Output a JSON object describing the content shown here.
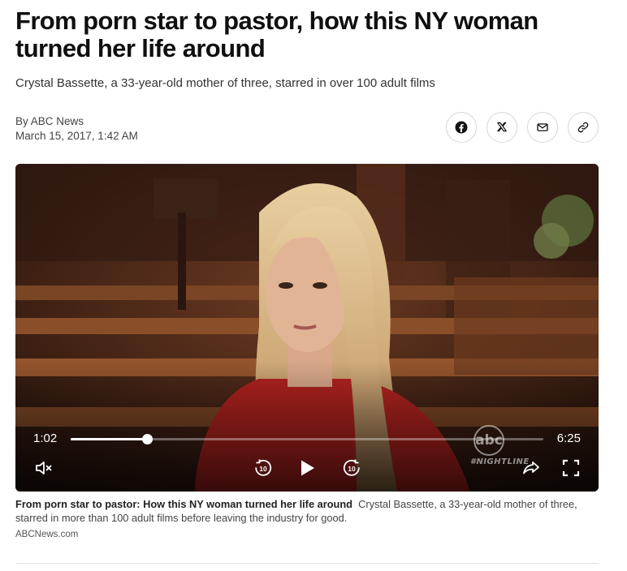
{
  "article": {
    "headline": "From porn star to pastor, how this NY woman turned her life around",
    "subheadline": "Crystal Bassette, a 33-year-old mother of three, starred in over 100 adult films",
    "byline": "By ABC News",
    "date": "March 15, 2017, 1:42 AM"
  },
  "share": [
    {
      "name": "facebook-icon",
      "label": "Share on Facebook"
    },
    {
      "name": "x-icon",
      "label": "Share on X"
    },
    {
      "name": "email-icon",
      "label": "Share via email"
    },
    {
      "name": "link-icon",
      "label": "Copy link"
    }
  ],
  "video": {
    "current_time": "1:02",
    "duration": "6:25",
    "progress_fraction": 0.161,
    "watermark_logo": "abc",
    "watermark_show": "#NIGHTLINE",
    "controls": {
      "mute": "volume-muted-icon",
      "rewind": "rewind-10-icon",
      "play": "play-icon",
      "forward": "forward-10-icon",
      "share": "share-arrow-icon",
      "fullscreen": "fullscreen-icon"
    },
    "skip_seconds": "10"
  },
  "caption": {
    "title": "From porn star to pastor: How this NY woman turned her life around",
    "text": "Crystal Bassette, a 33-year-old mother of three, starred in more than 100 adult films before leaving the industry for good.",
    "credit": "ABCNews.com"
  },
  "colors": {
    "text": "#0f0f0f",
    "muted": "#444444",
    "video_background": "#2a1710"
  }
}
